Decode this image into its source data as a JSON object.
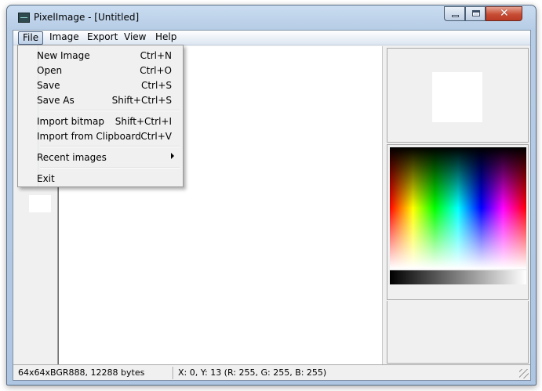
{
  "window": {
    "title": "PixelImage - [Untitled]",
    "icon": "app-icon"
  },
  "menubar": {
    "items": [
      "File",
      "Image",
      "Export",
      "View",
      "Help"
    ],
    "active": "File"
  },
  "file_menu": {
    "items": [
      {
        "label": "New Image",
        "shortcut": "Ctrl+N"
      },
      {
        "label": "Open",
        "shortcut": "Ctrl+O"
      },
      {
        "label": "Save",
        "shortcut": "Ctrl+S"
      },
      {
        "label": "Save As",
        "shortcut": "Shift+Ctrl+S"
      },
      {
        "label": "Import bitmap",
        "shortcut": "Shift+Ctrl+I"
      },
      {
        "label": "Import from Clipboard",
        "shortcut": "Ctrl+V"
      },
      {
        "label": "Recent images",
        "shortcut": ""
      },
      {
        "label": "Exit",
        "shortcut": ""
      }
    ]
  },
  "statusbar": {
    "image_info": "64x64xBGR888, 12288 bytes",
    "cursor_info": "X: 0, Y: 13 (R: 255, G: 255, B: 255)"
  },
  "colors": {
    "preview_fill": "#ffffff",
    "title_accent": "#b7cde6",
    "close_button": "#c74d35"
  }
}
